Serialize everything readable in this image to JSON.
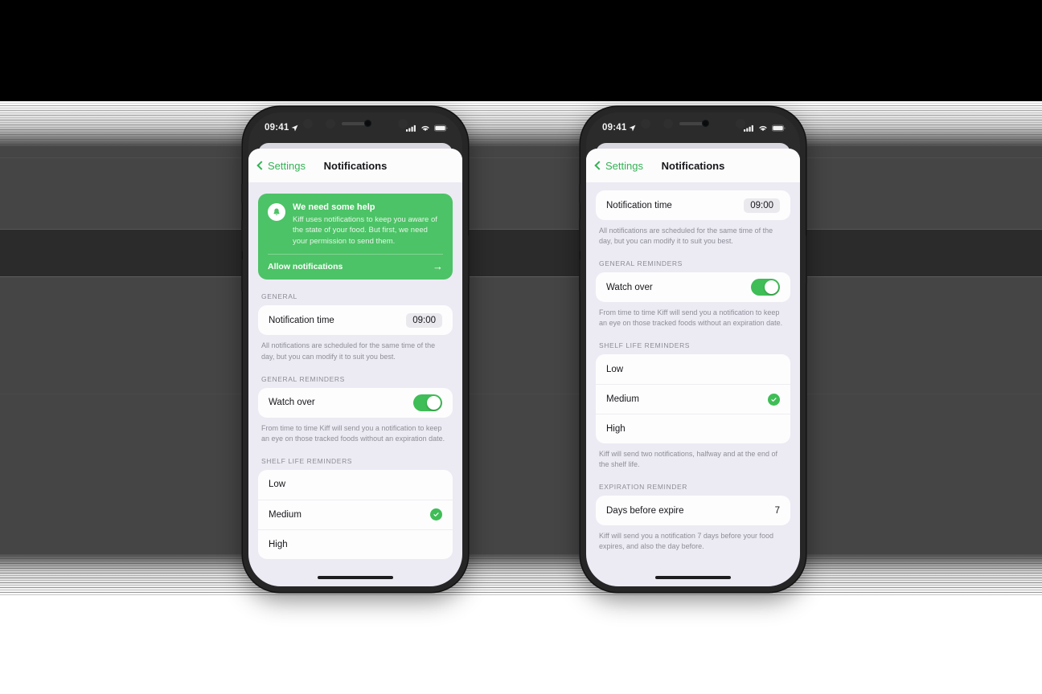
{
  "background": {
    "page_bg": "#ffffff",
    "band_dark": "#454545",
    "band_darker": "#2b2b2b",
    "band_black": "#000000"
  },
  "theme": {
    "accent_green": "#4cc366",
    "toggle_green": "#3fbd56",
    "link_green": "#34b254",
    "sheet_bg": "#ecebf3",
    "card_bg": "#fdfdfe",
    "text_primary": "#17171b",
    "text_secondary": "#8e8e98"
  },
  "status_bar": {
    "time": "09:41",
    "location_icon": "location-arrow-icon",
    "cellular_icon": "cellular-bars-icon",
    "wifi_icon": "wifi-icon",
    "battery_icon": "battery-icon"
  },
  "nav": {
    "back_label": "Settings",
    "back_icon": "chevron-left-icon",
    "title": "Notifications"
  },
  "phones": [
    {
      "id": "left",
      "banner": {
        "icon": "bell-icon",
        "heading": "We need some help",
        "body": "Kiff uses notifications to keep you aware of the state of your food. But first, we need your permission to send them.",
        "cta_label": "Allow notifications",
        "cta_icon": "arrow-right-icon"
      },
      "sections": [
        {
          "header": "GENERAL",
          "rows": [
            {
              "label": "Notification time",
              "value": "09:00",
              "value_style": "pill"
            }
          ],
          "footer": "All notifications are scheduled for the same time of the day, but you can modify it to suit you best."
        },
        {
          "header": "GENERAL REMINDERS",
          "rows": [
            {
              "label": "Watch over",
              "control": "toggle",
              "toggle_on": true
            }
          ],
          "footer": "From time to time Kiff will send you a notification to keep an eye on those tracked foods without an expiration date."
        },
        {
          "header": "SHELF LIFE REMINDERS",
          "rows": [
            {
              "label": "Low",
              "selected": false
            },
            {
              "label": "Medium",
              "selected": true
            },
            {
              "label": "High",
              "selected": false
            }
          ],
          "footer": ""
        }
      ]
    },
    {
      "id": "right",
      "banner": null,
      "sections": [
        {
          "header": "",
          "rows": [
            {
              "label": "Notification time",
              "value": "09:00",
              "value_style": "pill"
            }
          ],
          "footer": "All notifications are scheduled for the same time of the day, but you can modify it to suit you best."
        },
        {
          "header": "GENERAL REMINDERS",
          "rows": [
            {
              "label": "Watch over",
              "control": "toggle",
              "toggle_on": true
            }
          ],
          "footer": "From time to time Kiff will send you a notification to keep an eye on those tracked foods without an expiration date."
        },
        {
          "header": "SHELF LIFE REMINDERS",
          "rows": [
            {
              "label": "Low",
              "selected": false
            },
            {
              "label": "Medium",
              "selected": true
            },
            {
              "label": "High",
              "selected": false
            }
          ],
          "footer": "Kiff will send two notifications, halfway and at the end of the shelf life."
        },
        {
          "header": "EXPIRATION REMINDER",
          "rows": [
            {
              "label": "Days before expire",
              "value": "7",
              "value_style": "plain"
            }
          ],
          "footer": "Kiff will send you a notification 7 days before your food expires, and also the day before."
        }
      ]
    }
  ]
}
